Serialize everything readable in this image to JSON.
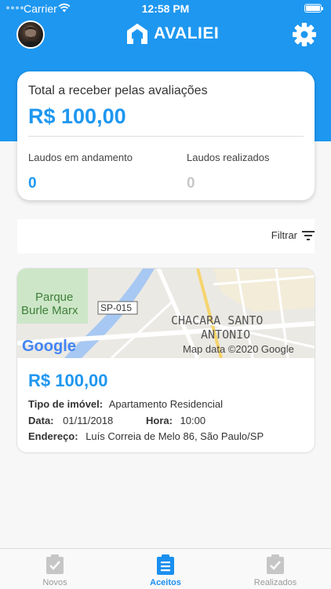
{
  "status_bar": {
    "carrier": "Carrier",
    "time": "12:58 PM"
  },
  "header": {
    "logo_text": "AVALIEI"
  },
  "summary": {
    "title": "Total a receber pelas avaliações",
    "amount": "R$ 100,00",
    "in_progress_label": "Laudos em andamento",
    "in_progress_value": "0",
    "done_label": "Laudos realizados",
    "done_value": "0"
  },
  "filter": {
    "label": "Filtrar"
  },
  "card": {
    "map": {
      "label_park_1": "Parque",
      "label_park_2": "Burle Marx",
      "road_shield": "SP-015",
      "label_district_1": "CHACARA SANTO",
      "label_district_2": "ANTONIO",
      "google": "Google",
      "attribution": "Map data ©2020 Google"
    },
    "price": "R$ 100,00",
    "type_label": "Tipo de imóvel:",
    "type_value": "Apartamento Residencial",
    "date_label": "Data:",
    "date_value": "01/11/2018",
    "time_label": "Hora:",
    "time_value": "10:00",
    "address_label": "Endereço:",
    "address_value": "Luís Correia de Melo 86, São Paulo/SP"
  },
  "nav": {
    "items": [
      {
        "label": "Novos",
        "active": false
      },
      {
        "label": "Aceitos",
        "active": true
      },
      {
        "label": "Realizados",
        "active": false
      }
    ]
  },
  "colors": {
    "primary": "#1e97f0",
    "inactive": "#b9b9b9",
    "active_nav": "#1a8ff0"
  }
}
